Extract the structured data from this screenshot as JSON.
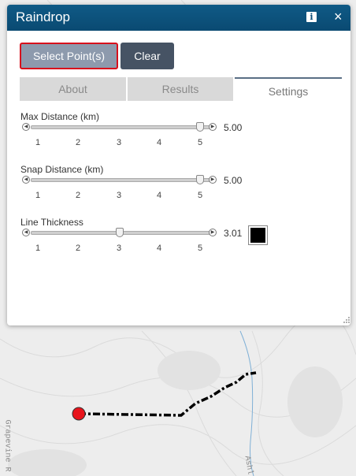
{
  "map": {
    "labels": {
      "road_left": "Grapevine R",
      "road_bottom": "Ashl"
    },
    "route_color": "#000000",
    "start_marker_color": "#e8141c",
    "stream_color": "#7fb0d6"
  },
  "widget": {
    "title": "Raindrop",
    "info_icon": "i",
    "close_icon": "×",
    "select_button": "Select Point(s)",
    "clear_button": "Clear",
    "tabs": [
      {
        "label": "About",
        "active": false
      },
      {
        "label": "Results",
        "active": false
      },
      {
        "label": "Settings",
        "active": true
      }
    ],
    "ticks": [
      "1",
      "2",
      "3",
      "4",
      "5"
    ],
    "settings": [
      {
        "label": "Max Distance (km)",
        "value": "5.00",
        "fraction": 1.0
      },
      {
        "label": "Snap Distance (km)",
        "value": "5.00",
        "fraction": 1.0
      },
      {
        "label": "Line Thickness",
        "value": "3.01",
        "fraction": 0.5
      }
    ],
    "line_color": "#000000"
  }
}
